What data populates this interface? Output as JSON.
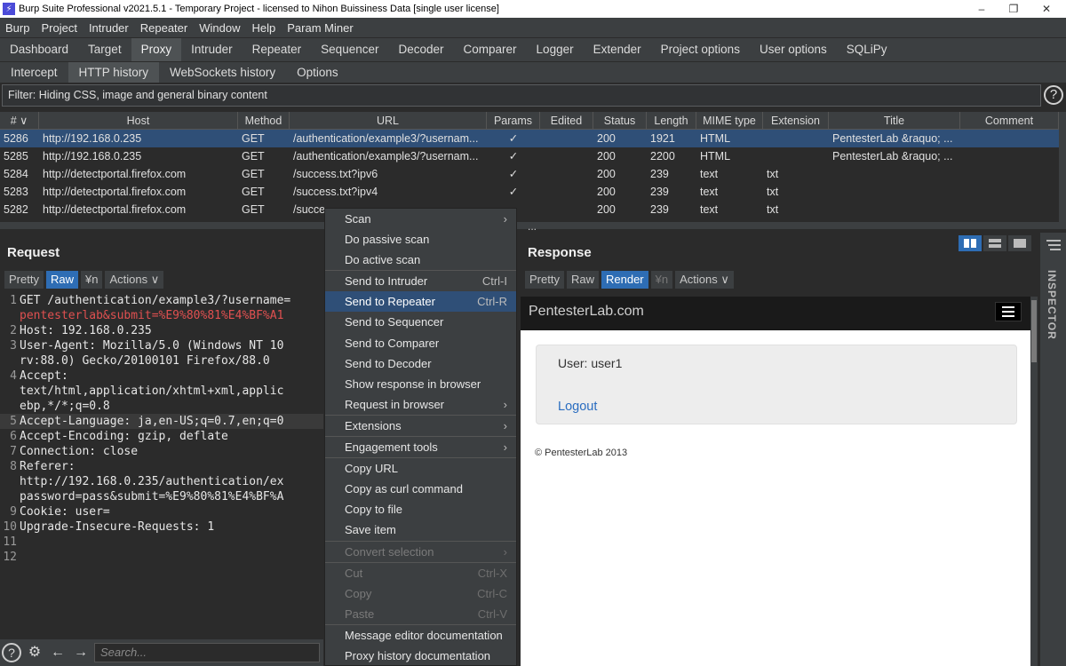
{
  "window": {
    "title": "Burp Suite Professional v2021.5.1 - Temporary Project - licensed to Nihon Buissiness Data [single user license]",
    "minimize": "–",
    "maximize": "❐",
    "close": "✕"
  },
  "menu": [
    "Burp",
    "Project",
    "Intruder",
    "Repeater",
    "Window",
    "Help",
    "Param Miner"
  ],
  "main_tabs": [
    "Dashboard",
    "Target",
    "Proxy",
    "Intruder",
    "Repeater",
    "Sequencer",
    "Decoder",
    "Comparer",
    "Logger",
    "Extender",
    "Project options",
    "User options",
    "SQLiPy"
  ],
  "active_main_tab": "Proxy",
  "proxy_tabs": [
    "Intercept",
    "HTTP history",
    "WebSockets history",
    "Options"
  ],
  "active_proxy_tab": "HTTP history",
  "filter": "Filter: Hiding CSS, image and general binary content",
  "history": {
    "columns": [
      "# ∨",
      "Host",
      "Method",
      "URL",
      "Params",
      "Edited",
      "Status",
      "Length",
      "MIME type",
      "Extension",
      "Title",
      "Comment"
    ],
    "rows": [
      {
        "num": "5286",
        "host": "http://192.168.0.235",
        "method": "GET",
        "url": "/authentication/example3/?usernam...",
        "params": "✓",
        "edited": "",
        "status": "200",
        "length": "1921",
        "mime": "HTML",
        "ext": "",
        "title": "PentesterLab &raquo; ...",
        "comment": ""
      },
      {
        "num": "5285",
        "host": "http://192.168.0.235",
        "method": "GET",
        "url": "/authentication/example3/?usernam...",
        "params": "✓",
        "edited": "",
        "status": "200",
        "length": "2200",
        "mime": "HTML",
        "ext": "",
        "title": "PentesterLab &raquo; ...",
        "comment": ""
      },
      {
        "num": "5284",
        "host": "http://detectportal.firefox.com",
        "method": "GET",
        "url": "/success.txt?ipv6",
        "params": "✓",
        "edited": "",
        "status": "200",
        "length": "239",
        "mime": "text",
        "ext": "txt",
        "title": "",
        "comment": ""
      },
      {
        "num": "5283",
        "host": "http://detectportal.firefox.com",
        "method": "GET",
        "url": "/success.txt?ipv4",
        "params": "✓",
        "edited": "",
        "status": "200",
        "length": "239",
        "mime": "text",
        "ext": "txt",
        "title": "",
        "comment": ""
      },
      {
        "num": "5282",
        "host": "http://detectportal.firefox.com",
        "method": "GET",
        "url": "/succe",
        "params": "",
        "edited": "",
        "status": "200",
        "length": "239",
        "mime": "text",
        "ext": "txt",
        "title": "",
        "comment": ""
      }
    ]
  },
  "request": {
    "title": "Request",
    "buttons": [
      "Pretty",
      "Raw",
      "¥n",
      "Actions ∨"
    ],
    "active_button": "Raw",
    "lines": [
      {
        "n": "1",
        "t": "GET /authentication/example3/?username="
      },
      {
        "n": "",
        "t": "pentesterlab&submit=%E9%80%81%E4%BF%A1"
      },
      {
        "n": "2",
        "t": "Host: 192.168.0.235"
      },
      {
        "n": "3",
        "t": "User-Agent: Mozilla/5.0 (Windows NT 10"
      },
      {
        "n": "",
        "t": "rv:88.0) Gecko/20100101 Firefox/88.0"
      },
      {
        "n": "4",
        "t": "Accept:"
      },
      {
        "n": "",
        "t": "text/html,application/xhtml+xml,applic"
      },
      {
        "n": "",
        "t": "ebp,*/*;q=0.8"
      },
      {
        "n": "5",
        "t": "Accept-Language: ja,en-US;q=0.7,en;q=0"
      },
      {
        "n": "6",
        "t": "Accept-Encoding: gzip, deflate"
      },
      {
        "n": "7",
        "t": "Connection: close"
      },
      {
        "n": "8",
        "t": "Referer:"
      },
      {
        "n": "",
        "t": "http://192.168.0.235/authentication/ex"
      },
      {
        "n": "",
        "t": "password=pass&submit=%E9%80%81%E4%BF%A"
      },
      {
        "n": "9",
        "t": "Cookie: user="
      },
      {
        "n": "10",
        "t": "Upgrade-Insecure-Requests: 1"
      },
      {
        "n": "11",
        "t": ""
      },
      {
        "n": "12",
        "t": ""
      }
    ],
    "search_placeholder": "Search..."
  },
  "context_menu": [
    {
      "label": "Scan",
      "shortcut": "›",
      "state": "normal",
      "sep_after": false
    },
    {
      "label": "Do passive scan",
      "shortcut": "",
      "state": "normal",
      "sep_after": false
    },
    {
      "label": "Do active scan",
      "shortcut": "",
      "state": "normal",
      "sep_after": true
    },
    {
      "label": "Send to Intruder",
      "shortcut": "Ctrl-I",
      "state": "normal",
      "sep_after": false
    },
    {
      "label": "Send to Repeater",
      "shortcut": "Ctrl-R",
      "state": "hover",
      "sep_after": false
    },
    {
      "label": "Send to Sequencer",
      "shortcut": "",
      "state": "normal",
      "sep_after": false
    },
    {
      "label": "Send to Comparer",
      "shortcut": "",
      "state": "normal",
      "sep_after": false
    },
    {
      "label": "Send to Decoder",
      "shortcut": "",
      "state": "normal",
      "sep_after": false
    },
    {
      "label": "Show response in browser",
      "shortcut": "",
      "state": "normal",
      "sep_after": false
    },
    {
      "label": "Request in browser",
      "shortcut": "›",
      "state": "normal",
      "sep_after": true
    },
    {
      "label": "Extensions",
      "shortcut": "›",
      "state": "normal",
      "sep_after": true
    },
    {
      "label": "Engagement tools",
      "shortcut": "›",
      "state": "normal",
      "sep_after": true
    },
    {
      "label": "Copy URL",
      "shortcut": "",
      "state": "normal",
      "sep_after": false
    },
    {
      "label": "Copy as curl command",
      "shortcut": "",
      "state": "normal",
      "sep_after": false
    },
    {
      "label": "Copy to file",
      "shortcut": "",
      "state": "normal",
      "sep_after": false
    },
    {
      "label": "Save item",
      "shortcut": "",
      "state": "normal",
      "sep_after": true
    },
    {
      "label": "Convert selection",
      "shortcut": "›",
      "state": "disabled",
      "sep_after": true
    },
    {
      "label": "Cut",
      "shortcut": "Ctrl-X",
      "state": "disabled",
      "sep_after": false
    },
    {
      "label": "Copy",
      "shortcut": "Ctrl-C",
      "state": "disabled",
      "sep_after": false
    },
    {
      "label": "Paste",
      "shortcut": "Ctrl-V",
      "state": "disabled",
      "sep_after": true
    },
    {
      "label": "Message editor documentation",
      "shortcut": "",
      "state": "normal",
      "sep_after": false
    },
    {
      "label": "Proxy history documentation",
      "shortcut": "",
      "state": "normal",
      "sep_after": false
    }
  ],
  "response": {
    "title": "Response",
    "buttons": [
      "Pretty",
      "Raw",
      "Render",
      "¥n",
      "Actions ∨"
    ],
    "active_button": "Render",
    "render": {
      "brand": "PentesterLab.com",
      "user": "User: user1",
      "logout": "Logout",
      "copyright": "© PentesterLab 2013"
    }
  },
  "inspector": "INSPECTOR",
  "more_dots": "...",
  "help": "?",
  "icons": {
    "settings": "gear-icon",
    "back": "arrow-left-icon",
    "forward": "arrow-right-icon"
  }
}
